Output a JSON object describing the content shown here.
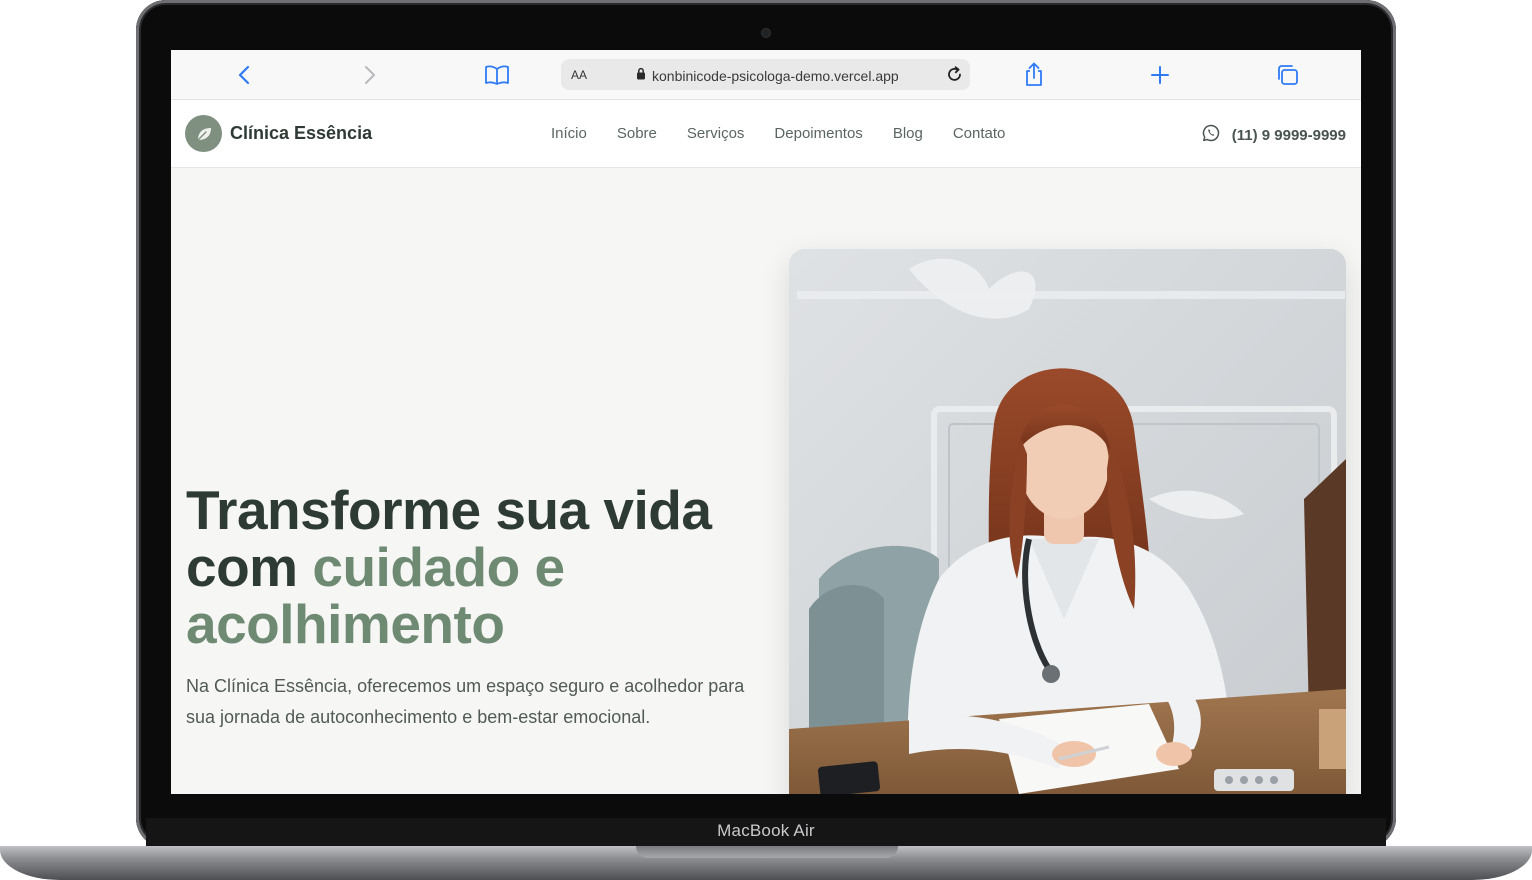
{
  "device": {
    "model_label": "MacBook Air"
  },
  "browser": {
    "aa_label": "AA",
    "url": "konbinicode-psicologa-demo.vercel.app",
    "icons": [
      "chevron-left-icon",
      "chevron-right-icon",
      "book-icon",
      "lock-icon",
      "reload-icon",
      "share-icon",
      "plus-icon",
      "tabs-icon"
    ]
  },
  "site": {
    "brand": "Clínica Essência",
    "nav": [
      "Início",
      "Sobre",
      "Serviços",
      "Depoimentos",
      "Blog",
      "Contato"
    ],
    "phone": "(11) 9 9999-9999",
    "colors": {
      "primary_text": "#2e3b34",
      "accent": "#6f8a72",
      "logo_bg": "#7f8f80"
    }
  },
  "hero": {
    "title_line1": "Transforme sua vida",
    "title_com": "com ",
    "title_accent1": "cuidado e",
    "title_accent2": "acolhimento",
    "description": "Na Clínica Essência, oferecemos um espaço seguro e acolhedor para sua jornada de autoconhecimento e bem-estar emocional."
  }
}
